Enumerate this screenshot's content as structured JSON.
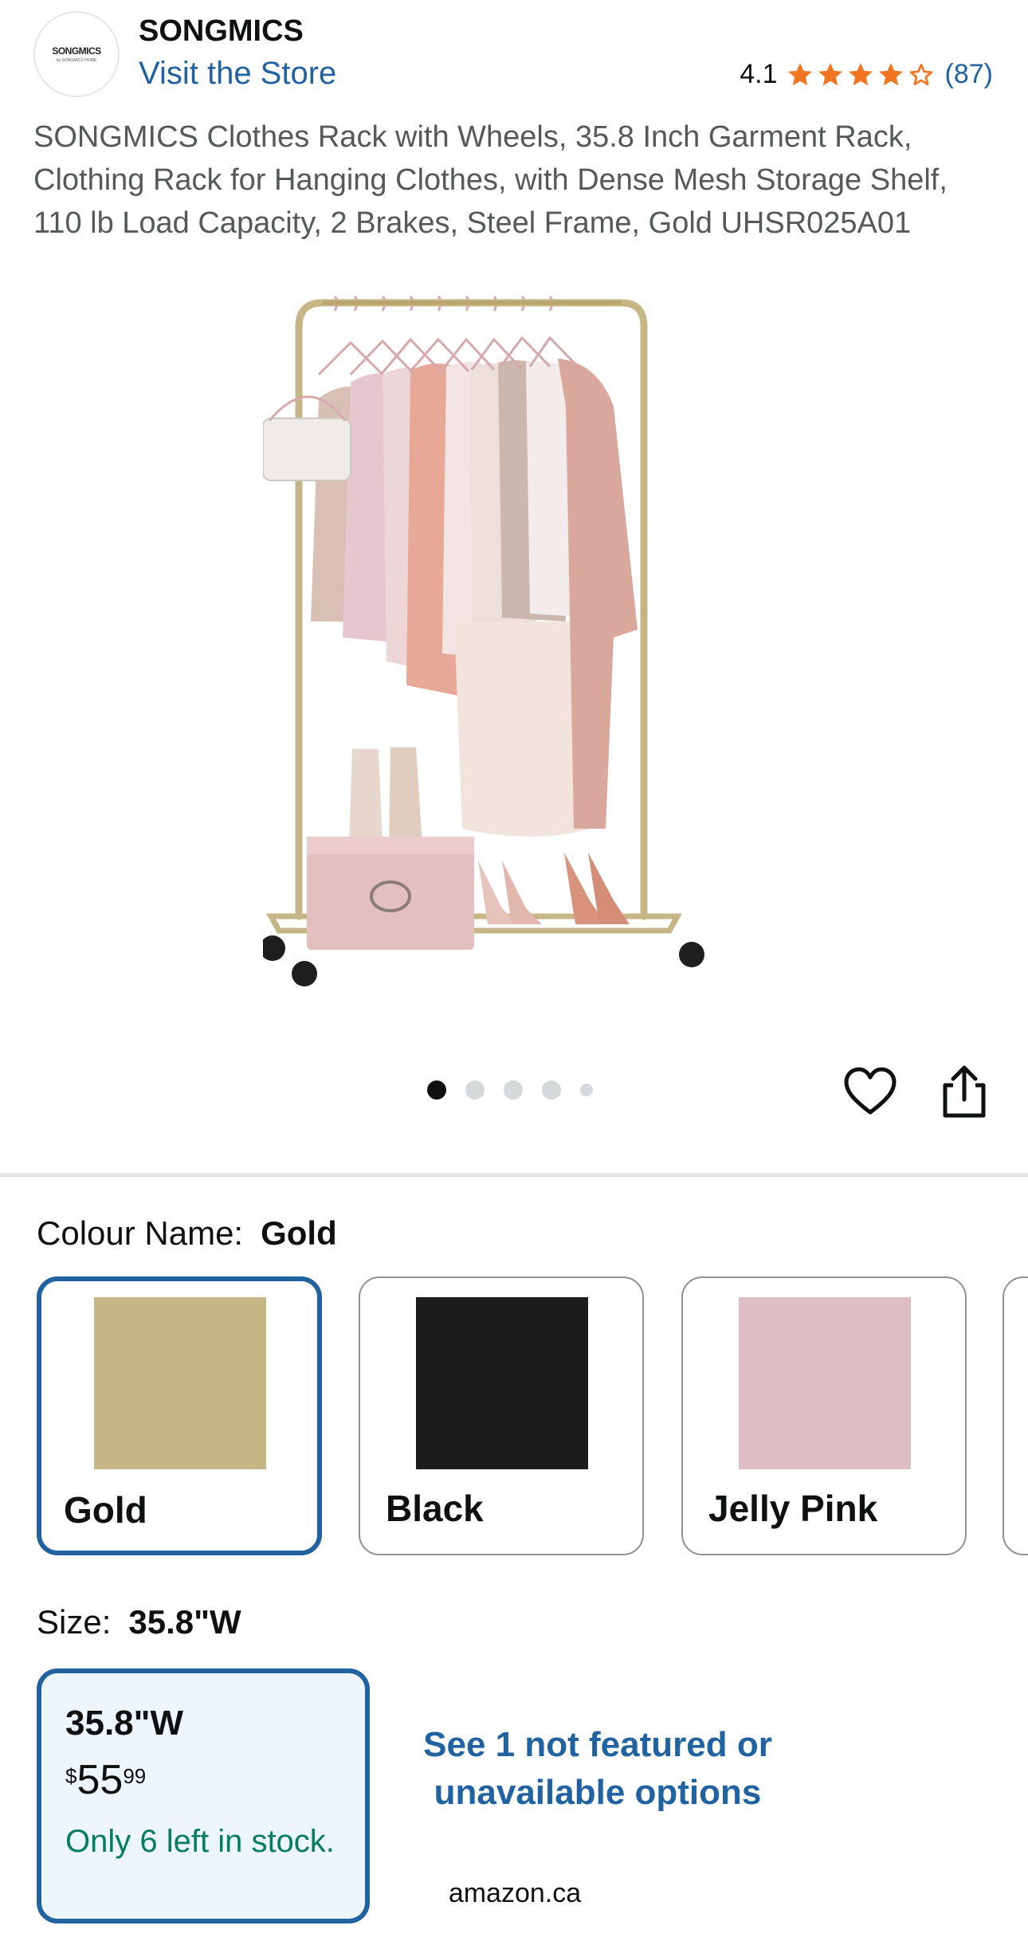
{
  "store": {
    "logo_text": "SONGMICS",
    "logo_subtext": "by SONGMICS HOME",
    "name": "SONGMICS",
    "visit_link": "Visit the Store"
  },
  "rating": {
    "value": "4.1",
    "stars": 4,
    "count": "(87)",
    "star_color": "#f47521"
  },
  "product": {
    "title": "SONGMICS Clothes Rack with Wheels, 35.8 Inch Garment Rack, Clothing Rack for Hanging Clothes, with Dense Mesh Storage Shelf, 110 lb Load Capacity, 2 Brakes, Steel Frame, Gold UHSR025A01",
    "image_alt": "Gold clothes rack with hanging garments, boots, a storage box and heels on the shelf",
    "image_count": 5,
    "active_image": 0
  },
  "actions": {
    "wishlist_icon": "heart-icon",
    "share_icon": "share-icon"
  },
  "colour": {
    "label": "Colour Name:",
    "selected": "Gold",
    "options": [
      {
        "name": "Gold",
        "swatch": "#c6b585",
        "selected": true
      },
      {
        "name": "Black",
        "swatch": "#1c1c1c",
        "selected": false
      },
      {
        "name": "Jelly Pink",
        "swatch": "#dfbdc4",
        "selected": false
      }
    ]
  },
  "size": {
    "label": "Size:",
    "selected": "35.8\"W",
    "option": {
      "name": "35.8\"W",
      "currency": "$",
      "price_whole": "55",
      "price_fraction": "99",
      "stock": "Only 6 left in stock."
    },
    "more_options": "See 1 not featured or unavailable options"
  },
  "browser": {
    "url": "amazon.ca"
  },
  "colors": {
    "link": "#2162a1",
    "in_stock": "#067d62",
    "selected_border": "#2162a1",
    "selected_bg": "#edf5fd"
  }
}
